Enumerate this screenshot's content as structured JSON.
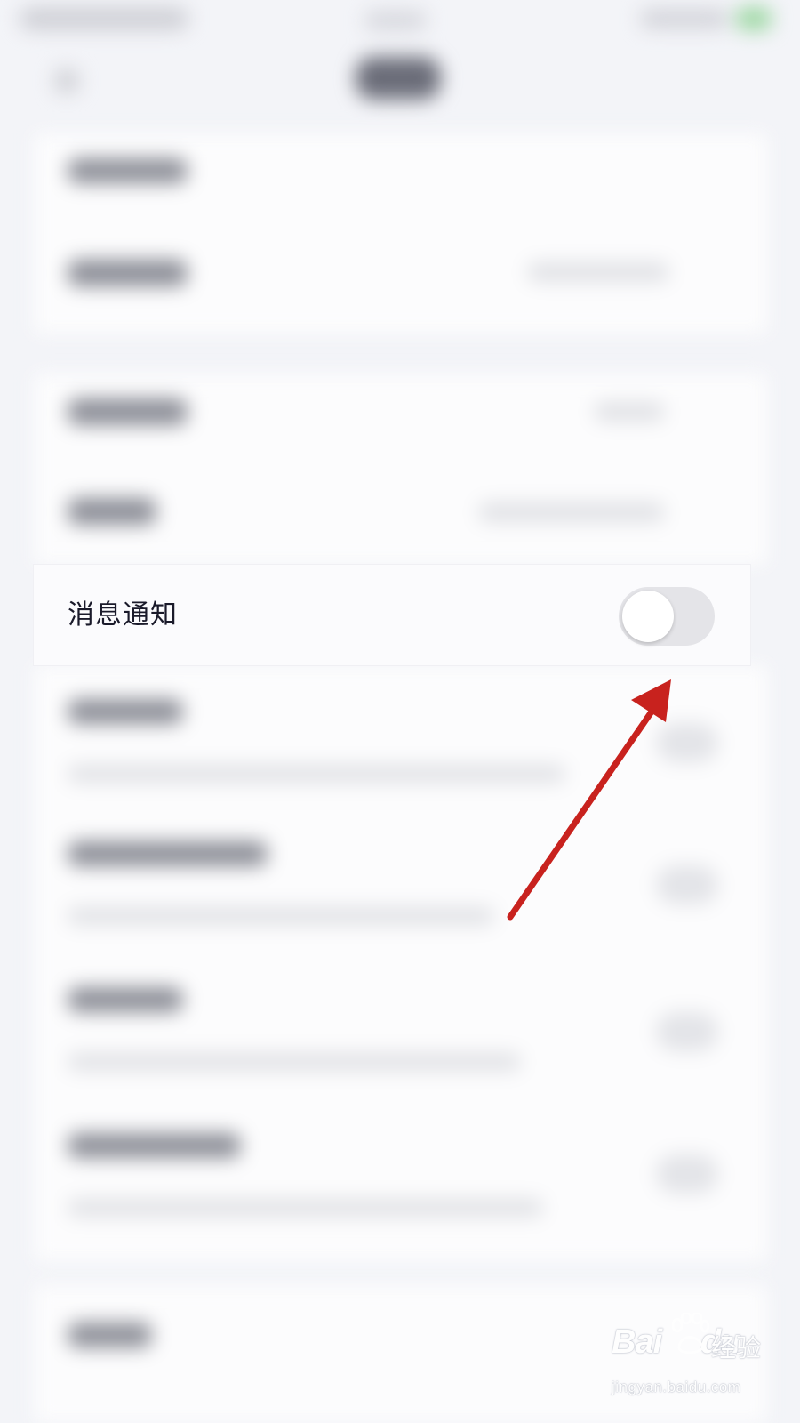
{
  "settings_row": {
    "label": "消息通知",
    "toggle_on": false
  },
  "watermark": {
    "brand": "Bai",
    "brand_suffix": "du",
    "product": "经验",
    "url": "jingyan.baidu.com"
  },
  "colors": {
    "annotation_arrow": "#c8221e",
    "toggle_off_track": "#e4e4e8",
    "label_text": "#1a1a2a"
  }
}
